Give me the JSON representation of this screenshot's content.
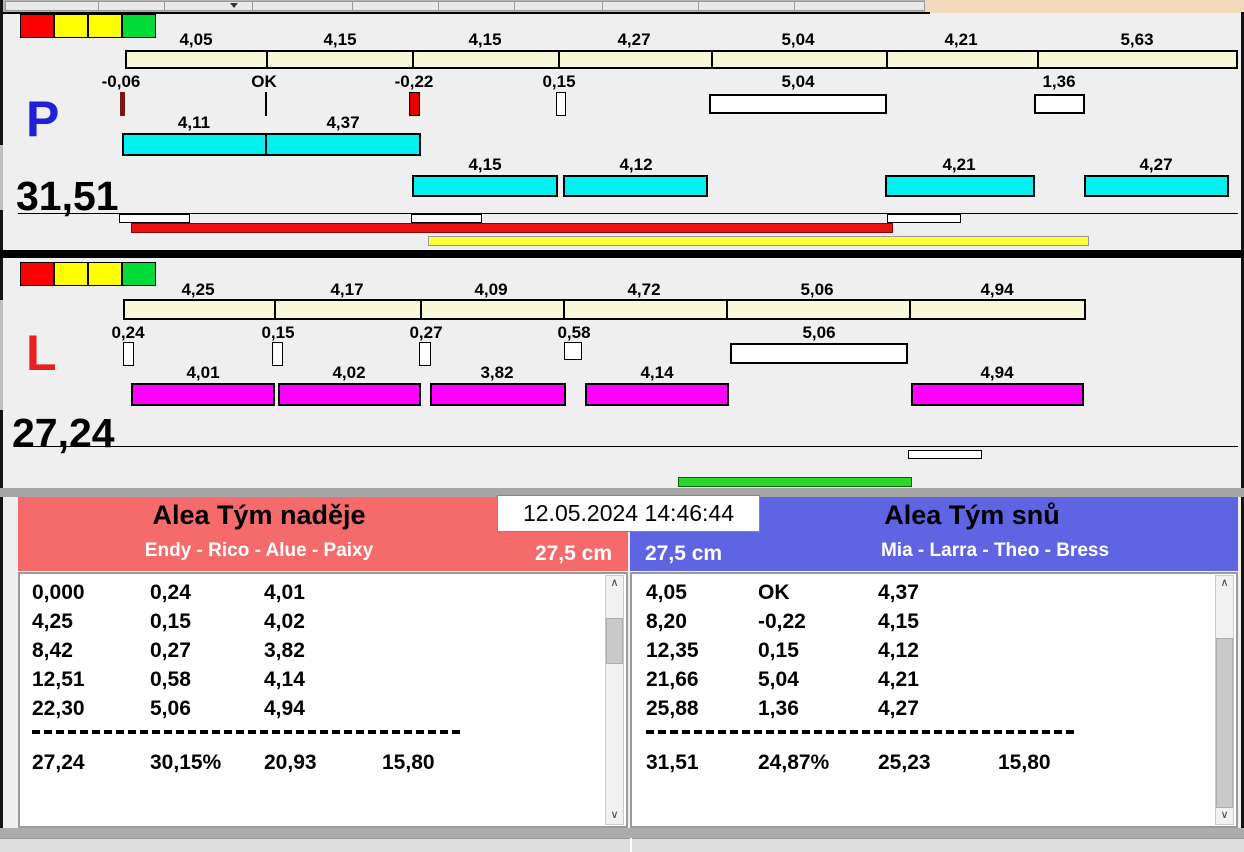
{
  "colors": {
    "ruler_bar": "#F8F8D8",
    "cyan_bar": "#00EFEF",
    "magenta_bar": "#FF00FF",
    "red_bar": "#E91111",
    "yellow_bar": "#FFFF3A",
    "green_bar": "#2ED52E",
    "team_left_bg": "#F56A6A",
    "team_right_bg": "#5F64E2",
    "lane_p_letter": "#2020D8",
    "lane_l_letter": "#E82020",
    "top_strip_tan": "#F3DABC"
  },
  "icons": {
    "scroll_up": "∧",
    "scroll_down": "∨"
  },
  "lane_p": {
    "letter": "P",
    "total": "31,51",
    "lights": [
      "red",
      "yellow",
      "yellow",
      "green"
    ],
    "ruler_labels": [
      "4,05",
      "4,15",
      "4,15",
      "4,27",
      "5,04",
      "4,21",
      "5,63"
    ],
    "delta_labels": [
      "-0,06",
      "OK",
      "-0,22",
      "0,15",
      "5,04",
      "1,36"
    ],
    "run1_labels": [
      "4,11",
      "4,37"
    ],
    "run2_labels": [
      "4,15",
      "4,12",
      "4,21",
      "4,27"
    ]
  },
  "lane_l": {
    "letter": "L",
    "total": "27,24",
    "lights": [
      "red",
      "yellow",
      "yellow",
      "green"
    ],
    "ruler_labels": [
      "4,25",
      "4,17",
      "4,09",
      "4,72",
      "5,06",
      "4,94"
    ],
    "delta_labels": [
      "0,24",
      "0,15",
      "0,27",
      "0,58",
      "5,06"
    ],
    "run1_labels": [
      "4,01",
      "4,02",
      "3,82",
      "4,14",
      "4,94"
    ]
  },
  "datetime": "12.05.2024 14:46:44",
  "team_left": {
    "name": "Alea Tým naděje",
    "members": "Endy - Rico - Alue - Paixy",
    "distance": "27,5 cm",
    "rows": [
      [
        "0,000",
        "0,24",
        "4,01"
      ],
      [
        "4,25",
        "0,15",
        "4,02"
      ],
      [
        "8,42",
        "0,27",
        "3,82"
      ],
      [
        "12,51",
        "0,58",
        "4,14"
      ],
      [
        "22,30",
        "5,06",
        "4,94"
      ]
    ],
    "totals": [
      "27,24",
      "30,15%",
      "20,93",
      "15,80"
    ]
  },
  "team_right": {
    "name": "Alea Tým snů",
    "members": "Mia - Larra - Theo - Bress",
    "distance": "27,5 cm",
    "rows": [
      [
        "4,05",
        "OK",
        "4,37"
      ],
      [
        "8,20",
        "-0,22",
        "4,15"
      ],
      [
        "12,35",
        "0,15",
        "4,12"
      ],
      [
        "21,66",
        "5,04",
        "4,21"
      ],
      [
        "25,88",
        "1,36",
        "4,27"
      ]
    ],
    "totals": [
      "31,51",
      "24,87%",
      "25,23",
      "15,80"
    ]
  }
}
